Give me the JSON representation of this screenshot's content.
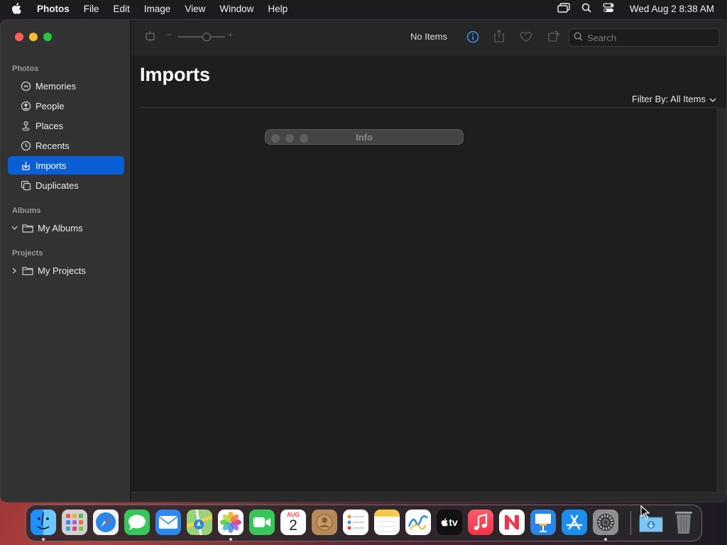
{
  "menubar": {
    "app_name": "Photos",
    "menus": [
      "File",
      "Edit",
      "Image",
      "View",
      "Window",
      "Help"
    ],
    "clock": "Wed Aug 2  8:38 AM"
  },
  "sidebar": {
    "section_photos": "Photos",
    "items": [
      {
        "label": "Memories",
        "icon": "memories-icon"
      },
      {
        "label": "People",
        "icon": "people-icon"
      },
      {
        "label": "Places",
        "icon": "places-icon"
      },
      {
        "label": "Recents",
        "icon": "recents-icon"
      },
      {
        "label": "Imports",
        "icon": "imports-icon",
        "active": true
      },
      {
        "label": "Duplicates",
        "icon": "duplicates-icon"
      }
    ],
    "section_albums": "Albums",
    "my_albums": "My Albums",
    "section_projects": "Projects",
    "my_projects": "My Projects"
  },
  "toolbar": {
    "status": "No Items",
    "search_placeholder": "Search",
    "zoom_minus": "−",
    "zoom_plus": "+"
  },
  "main": {
    "title": "Imports",
    "filter_label": "Filter By: All Items"
  },
  "info_panel": {
    "title": "Info"
  },
  "dock": {
    "apps": [
      "Finder",
      "Launchpad",
      "Safari",
      "Messages",
      "Mail",
      "Maps",
      "Photos",
      "FaceTime",
      "Calendar",
      "Contacts",
      "Reminders",
      "Notes",
      "Freeform",
      "TV",
      "Music",
      "News",
      "Keynote",
      "App Store",
      "System Settings",
      "Downloads",
      "Trash"
    ],
    "calendar_month": "AUG",
    "calendar_day": "2",
    "tv_label": "tv"
  },
  "colors": {
    "accent": "#0a5fd6",
    "info_blue": "#3a8ff5"
  }
}
